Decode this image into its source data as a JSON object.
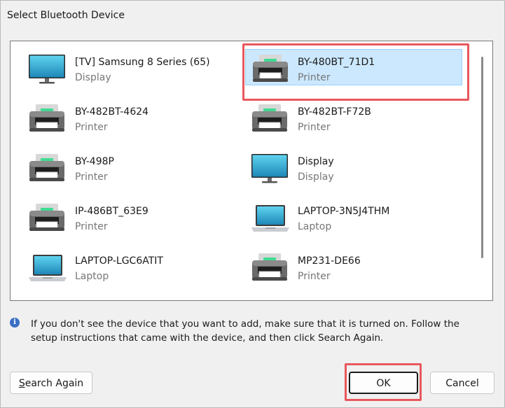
{
  "dialog": {
    "title": "Select Bluetooth Device"
  },
  "devices": [
    {
      "name": "[TV] Samsung 8 Series (65)",
      "type": "Display",
      "icon": "display-icon",
      "selected": false
    },
    {
      "name": "BY-480BT_71D1",
      "type": "Printer",
      "icon": "printer-icon",
      "selected": true
    },
    {
      "name": "BY-482BT-4624",
      "type": "Printer",
      "icon": "printer-icon",
      "selected": false
    },
    {
      "name": "BY-482BT-F72B",
      "type": "Printer",
      "icon": "printer-icon",
      "selected": false
    },
    {
      "name": "BY-498P",
      "type": "Printer",
      "icon": "printer-icon",
      "selected": false
    },
    {
      "name": "Display",
      "type": "Display",
      "icon": "display-icon",
      "selected": false
    },
    {
      "name": "IP-486BT_63E9",
      "type": "Printer",
      "icon": "printer-icon",
      "selected": false
    },
    {
      "name": "LAPTOP-3N5J4THM",
      "type": "Laptop",
      "icon": "laptop-icon",
      "selected": false
    },
    {
      "name": "LAPTOP-LGC6ATIT",
      "type": "Laptop",
      "icon": "laptop-icon",
      "selected": false
    },
    {
      "name": "MP231-DE66",
      "type": "Printer",
      "icon": "printer-icon",
      "selected": false
    }
  ],
  "info": {
    "icon": "info-icon",
    "glyph": "i",
    "text": "If you don't see the device that you want to add, make sure that it is turned on. Follow the setup instructions that came with the device, and then click Search Again."
  },
  "buttons": {
    "search_again_first": "S",
    "search_again_rest": "earch Again",
    "ok": "OK",
    "cancel": "Cancel"
  },
  "colors": {
    "selection_bg": "#cce8ff",
    "highlight_box": "#e8585d",
    "info_icon": "#3a6fc4"
  }
}
